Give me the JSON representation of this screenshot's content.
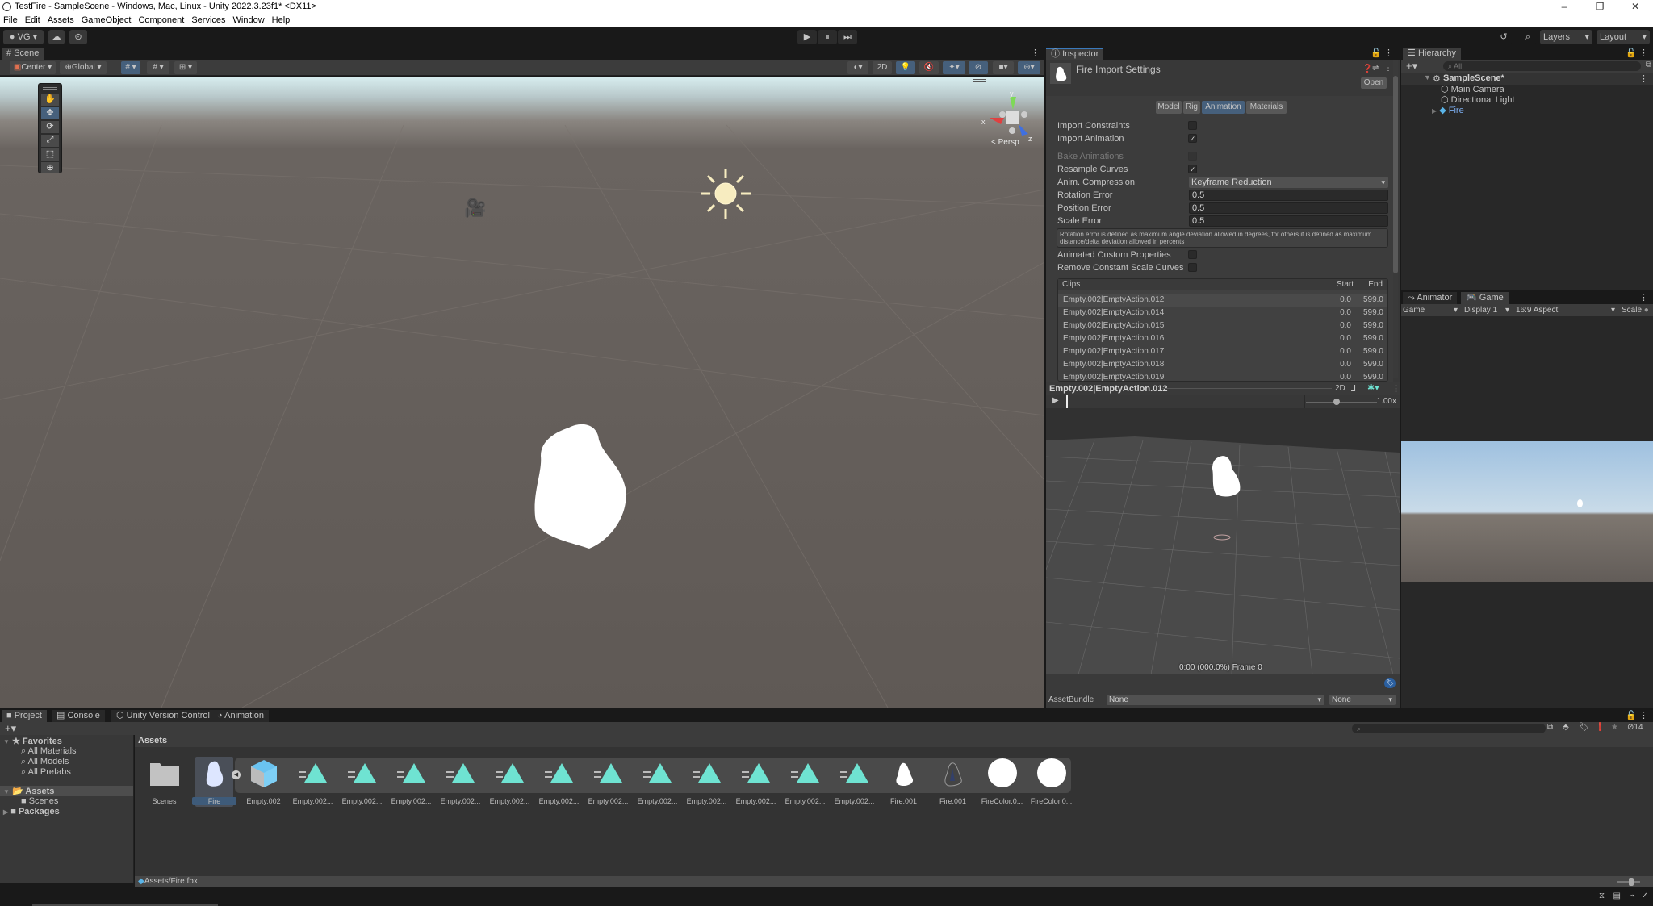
{
  "window": {
    "title": "TestFire - SampleScene - Windows, Mac, Linux - Unity 2022.3.23f1* <DX11>",
    "controls": [
      "–",
      "❐",
      "✕"
    ]
  },
  "menubar": [
    "File",
    "Edit",
    "Assets",
    "GameObject",
    "Component",
    "Services",
    "Window",
    "Help"
  ],
  "toolbar": {
    "account": "VG",
    "play": "▶",
    "pause": "⏸",
    "step": "⏭",
    "layers": "Layers",
    "layout": "Layout"
  },
  "scene": {
    "tab": "Scene",
    "pivot": "Center",
    "space": "Global",
    "mode_2d": "2D",
    "projection": "Persp",
    "gizmo_axes": {
      "x": "x",
      "y": "y",
      "z": "z"
    },
    "tools": [
      "hand",
      "move",
      "rotate",
      "scale",
      "rect",
      "transform"
    ],
    "active_tool": "move"
  },
  "inspector": {
    "tab": "Inspector",
    "title": "Fire Import Settings",
    "open_label": "Open",
    "tabs": [
      "Model",
      "Rig",
      "Animation",
      "Materials"
    ],
    "active_tab": "Animation",
    "fields": {
      "import_constraints": {
        "label": "Import Constraints",
        "checked": false
      },
      "import_animation": {
        "label": "Import Animation",
        "checked": true
      },
      "bake_animations": {
        "label": "Bake Animations",
        "checked": false,
        "disabled": true
      },
      "resample_curves": {
        "label": "Resample Curves",
        "checked": true
      },
      "anim_compression": {
        "label": "Anim. Compression",
        "value": "Keyframe Reduction"
      },
      "rotation_error": {
        "label": "Rotation Error",
        "value": "0.5"
      },
      "position_error": {
        "label": "Position Error",
        "value": "0.5"
      },
      "scale_error": {
        "label": "Scale Error",
        "value": "0.5"
      },
      "help_text": "Rotation error is defined as maximum angle deviation allowed in degrees, for others it is defined as maximum distance/delta deviation allowed in percents",
      "animated_custom_properties": {
        "label": "Animated Custom Properties",
        "checked": false
      },
      "remove_constant_scale_curves": {
        "label": "Remove Constant Scale Curves",
        "checked": false
      }
    },
    "clips": {
      "header": {
        "name": "Clips",
        "start": "Start",
        "end": "End"
      },
      "rows": [
        {
          "name": "Empty.002|EmptyAction.012",
          "start": "0.0",
          "end": "599.0"
        },
        {
          "name": "Empty.002|EmptyAction.014",
          "start": "0.0",
          "end": "599.0"
        },
        {
          "name": "Empty.002|EmptyAction.015",
          "start": "0.0",
          "end": "599.0"
        },
        {
          "name": "Empty.002|EmptyAction.016",
          "start": "0.0",
          "end": "599.0"
        },
        {
          "name": "Empty.002|EmptyAction.017",
          "start": "0.0",
          "end": "599.0"
        },
        {
          "name": "Empty.002|EmptyAction.018",
          "start": "0.0",
          "end": "599.0"
        },
        {
          "name": "Empty.002|EmptyAction.019",
          "start": "0.0",
          "end": "599.0"
        }
      ],
      "selected": 0
    },
    "preview": {
      "clip_name": "Empty.002|EmptyAction.012",
      "mode_2d": "2D",
      "speed": "1.00x",
      "speed_value": 1.0,
      "status": "0:00 (000.0%) Frame 0"
    },
    "asset_bundle": {
      "label": "AssetBundle",
      "value": "None",
      "variant": "None"
    }
  },
  "hierarchy": {
    "tab": "Hierarchy",
    "search_placeholder": "All",
    "scene": "SampleScene*",
    "items": [
      {
        "label": "Main Camera"
      },
      {
        "label": "Directional Light"
      },
      {
        "label": "Fire",
        "selected_prefab": true
      }
    ]
  },
  "game": {
    "tabs": [
      "Animator",
      "Game"
    ],
    "active_tab": "Game",
    "view": "Game",
    "display": "Display 1",
    "aspect": "16:9 Aspect",
    "scale_label": "Scale"
  },
  "project": {
    "tabs": [
      "Project",
      "Console",
      "Unity Version Control",
      "Animation"
    ],
    "active_tab": "Project",
    "hidden_count": "14",
    "sidebar": {
      "favorites": "Favorites",
      "favorite_items": [
        "All Materials",
        "All Models",
        "All Prefabs"
      ],
      "assets": "Assets",
      "asset_children": [
        "Scenes"
      ],
      "packages": "Packages"
    },
    "breadcrumb": "Assets",
    "assets": [
      {
        "name": "Scenes",
        "type": "folder"
      },
      {
        "name": "Fire",
        "type": "model",
        "selected": true
      },
      {
        "name": "Empty.002",
        "type": "prefab"
      },
      {
        "name": "Empty.002...",
        "type": "anim"
      },
      {
        "name": "Empty.002...",
        "type": "anim"
      },
      {
        "name": "Empty.002...",
        "type": "anim"
      },
      {
        "name": "Empty.002...",
        "type": "anim"
      },
      {
        "name": "Empty.002...",
        "type": "anim"
      },
      {
        "name": "Empty.002...",
        "type": "anim"
      },
      {
        "name": "Empty.002...",
        "type": "anim"
      },
      {
        "name": "Empty.002...",
        "type": "anim"
      },
      {
        "name": "Empty.002...",
        "type": "anim"
      },
      {
        "name": "Empty.002...",
        "type": "anim"
      },
      {
        "name": "Empty.002...",
        "type": "anim"
      },
      {
        "name": "Empty.002...",
        "type": "anim"
      },
      {
        "name": "Fire.001",
        "type": "mesh"
      },
      {
        "name": "Fire.001",
        "type": "texture"
      },
      {
        "name": "FireColor.0...",
        "type": "material"
      },
      {
        "name": "FireColor.0...",
        "type": "material"
      }
    ],
    "status_path": "Assets/Fire.fbx"
  }
}
